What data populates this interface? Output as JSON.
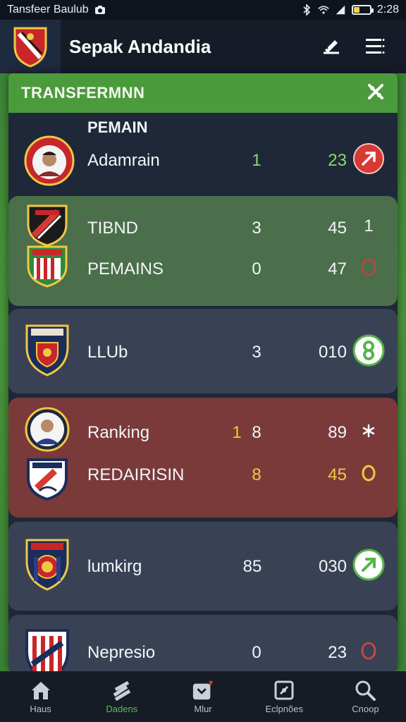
{
  "status_bar": {
    "app_name": "Tansfeer Baulub",
    "time": "2:28",
    "battery_level": 0.35,
    "icons": [
      "camera-icon",
      "bluetooth-icon",
      "wifi-icon",
      "signal-icon",
      "battery-icon"
    ]
  },
  "app_bar": {
    "title": "Sepak Andandia",
    "icons": [
      "club-crest-logo",
      "edit-icon",
      "menu-icon"
    ]
  },
  "panel": {
    "title": "TRANSFERMNN",
    "close_icon": "close-x-icon",
    "section_label": "PEMAIN",
    "rows": [
      {
        "name": "Adamrain",
        "v1": "1",
        "v2": "23",
        "v1_color": "#8fd66c",
        "v2_color": "#8fd66c",
        "action_icon": "arrow-diagonal-icon",
        "action_color": "#d63a33"
      },
      {
        "name": "TIBND",
        "v1": "3",
        "v2": "45",
        "extra": "1",
        "action_icon": "none"
      },
      {
        "name": "PEMAINS",
        "v1": "0",
        "v2": "47",
        "action_icon": "circle-outline-icon",
        "action_color": "#b4483d"
      },
      {
        "name": "LLUb",
        "v1": "3",
        "v2": "010",
        "action_icon": "refresh-icon",
        "action_color": "#55b548"
      },
      {
        "name": "Ranking",
        "v0": "1",
        "v1": "8",
        "v2": "89",
        "action_icon": "star-icon",
        "action_color": "#ffffff"
      },
      {
        "name": "REDAIRISIN",
        "v1": "8",
        "v2": "45",
        "v1_color": "#f0c93f",
        "v2_color": "#f0c93f",
        "action_icon": "circle-outline-icon",
        "action_color": "#f0c93f"
      },
      {
        "name": "lumkirg",
        "v1": "85",
        "v2": "030",
        "action_icon": "arrow-diagonal-icon",
        "action_color": "#55b548"
      },
      {
        "name": "Nepresio",
        "v1": "0",
        "v2": "23",
        "action_icon": "circle-outline-icon",
        "action_color": "#c6473f"
      }
    ]
  },
  "bottom_nav": {
    "items": [
      {
        "label": "Haus",
        "icon": "home-icon",
        "active": false
      },
      {
        "label": "Dadens",
        "icon": "layers-icon",
        "active": true
      },
      {
        "label": "Mlur",
        "icon": "shield-badge-icon",
        "active": false
      },
      {
        "label": "Eclpnões",
        "icon": "badge-frame-icon",
        "active": false
      },
      {
        "label": "Cnoop",
        "icon": "search-icon",
        "active": false
      }
    ]
  },
  "colors": {
    "panel_header": "#4b9a3b",
    "card_green": "#4b6e4b",
    "card_slate": "#394255",
    "card_red": "#7a3a3a",
    "panel_bg": "#1f2838"
  }
}
